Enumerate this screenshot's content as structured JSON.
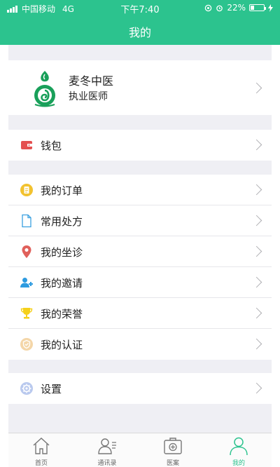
{
  "status_bar": {
    "carrier": "中国移动",
    "network": "4G",
    "time": "下午7:40",
    "battery": "22%"
  },
  "header": {
    "title": "我的"
  },
  "profile": {
    "name": "麦冬中医",
    "role": "执业医师"
  },
  "wallet": {
    "label": "钱包"
  },
  "menu": [
    {
      "label": "我的订单",
      "icon": "order-icon"
    },
    {
      "label": "常用处方",
      "icon": "prescription-icon"
    },
    {
      "label": "我的坐诊",
      "icon": "location-pin-icon"
    },
    {
      "label": "我的邀请",
      "icon": "invite-user-icon"
    },
    {
      "label": "我的荣誉",
      "icon": "trophy-icon"
    },
    {
      "label": "我的认证",
      "icon": "certification-icon"
    }
  ],
  "settings": {
    "label": "设置"
  },
  "tabs": [
    {
      "label": "首页",
      "icon": "home-icon"
    },
    {
      "label": "通讯录",
      "icon": "contacts-icon"
    },
    {
      "label": "医案",
      "icon": "medical-case-icon"
    },
    {
      "label": "我的",
      "icon": "profile-icon",
      "active": true
    }
  ],
  "colors": {
    "brand": "#2cc38e",
    "background": "#efeff4"
  }
}
